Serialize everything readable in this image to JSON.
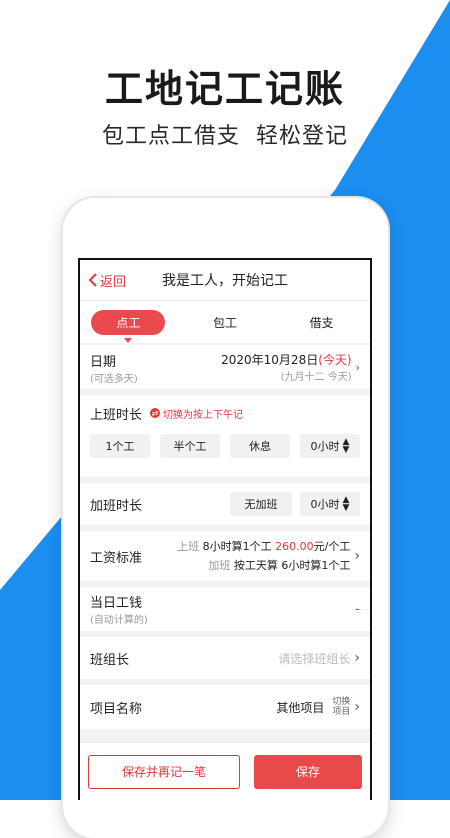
{
  "promo": {
    "headline": "工地记工记账",
    "tagline_left": "包工点工借支",
    "tagline_right": "轻松登记"
  },
  "nav": {
    "back_label": "返回",
    "title": "我是工人，开始记工"
  },
  "tabs": [
    {
      "label": "点工",
      "active": true
    },
    {
      "label": "包工",
      "active": false
    },
    {
      "label": "借支",
      "active": false
    }
  ],
  "date": {
    "label": "日期",
    "hint": "(可选多天)",
    "value": "2020年10月28日",
    "today_tag": "(今天)",
    "lunar": "(九月十二 今天)"
  },
  "work_hours": {
    "label": "上班时长",
    "toggle_text": "切换为按上下午记",
    "options": [
      "1个工",
      "半个工",
      "休息"
    ],
    "hours_value": "0小时"
  },
  "overtime": {
    "label": "加班时长",
    "none_label": "无加班",
    "hours_value": "0小时"
  },
  "wage": {
    "label": "工资标准",
    "work_tag": "上班",
    "work_rule": "8小时算1个工",
    "work_amount": "260.00",
    "work_unit": "元/个工",
    "ot_tag": "加班",
    "ot_mode": "按工天算",
    "ot_rule": "6小时算1个工"
  },
  "daily_pay": {
    "label": "当日工钱",
    "hint": "(自动计算的)",
    "value": "-"
  },
  "team_leader": {
    "label": "班组长",
    "placeholder": "请选择班组长"
  },
  "project": {
    "label": "项目名称",
    "value": "其他项目",
    "switch_line1": "切换",
    "switch_line2": "项目"
  },
  "footer": {
    "save_again": "保存并再记一笔",
    "save": "保存"
  },
  "colors": {
    "accent_red": "#e2373b",
    "promo_blue": "#1c8ef0"
  }
}
